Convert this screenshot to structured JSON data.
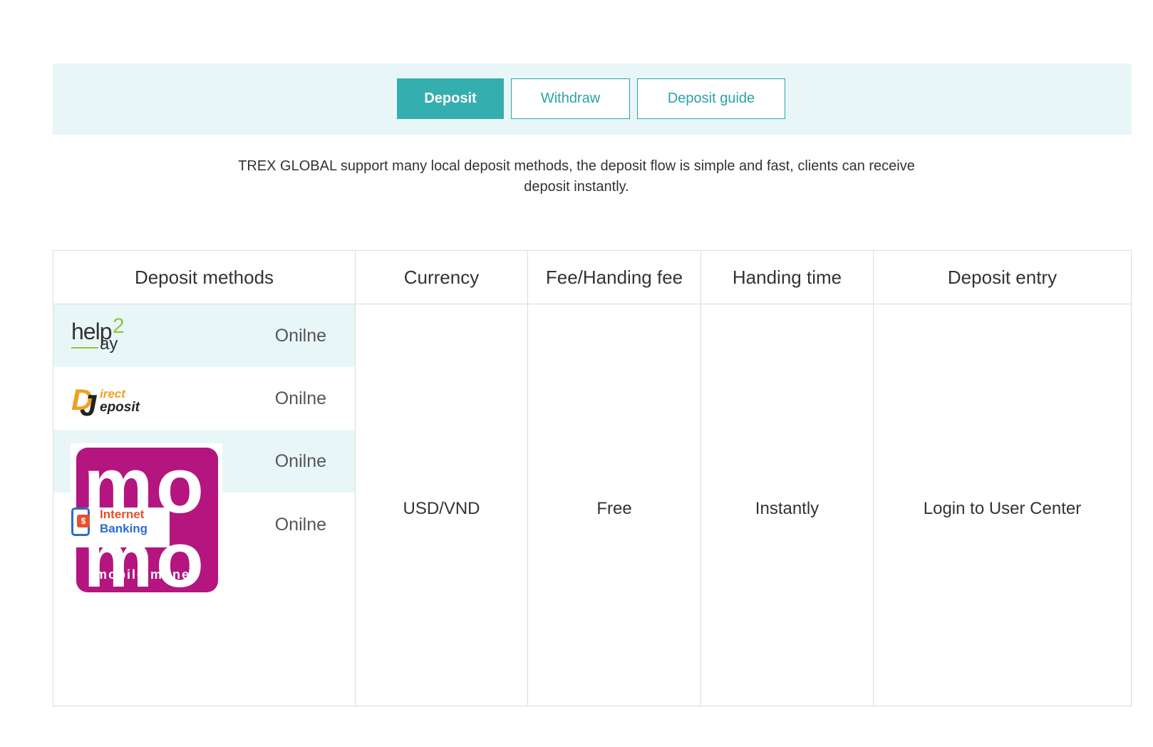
{
  "tabs": {
    "deposit": "Deposit",
    "withdraw": "Withdraw",
    "guide": "Deposit guide"
  },
  "intro": "TREX GLOBAL support many local deposit methods, the deposit flow is simple and fast, clients can receive deposit instantly.",
  "table": {
    "headers": {
      "methods": "Deposit methods",
      "currency": "Currency",
      "fee": "Fee/Handing fee",
      "time": "Handing time",
      "entry": "Deposit entry"
    },
    "methods": [
      {
        "logo": "help2pay-logo",
        "status": "Onilne"
      },
      {
        "logo": "direct-deposit-logo",
        "status": "Onilne"
      },
      {
        "logo": "mobile-money-logo",
        "status": "Onilne"
      },
      {
        "logo": "internet-banking-logo",
        "status": "Onilne"
      }
    ],
    "currency": "USD/VND",
    "fee": "Free",
    "time": "Instantly",
    "entry": "Login to User Center"
  },
  "logos": {
    "help2pay": {
      "a": "help",
      "b": "2",
      "c": "ay"
    },
    "direct_deposit": {
      "a": "irect",
      "b": "eposit"
    },
    "mobile_money": {
      "big": "mo",
      "small": "mobile money"
    },
    "internet_banking": {
      "a": "Internet",
      "b": "Banking",
      "coin": "$"
    }
  },
  "colors": {
    "accent": "#35aeb0",
    "tabbar_bg": "#e9f6f8",
    "mobile_money": "#b4157f",
    "help2pay_green": "#8cc63f",
    "direct_deposit_orange": "#f0a020",
    "internet_red": "#e8502a",
    "internet_blue": "#2a6bd6"
  }
}
